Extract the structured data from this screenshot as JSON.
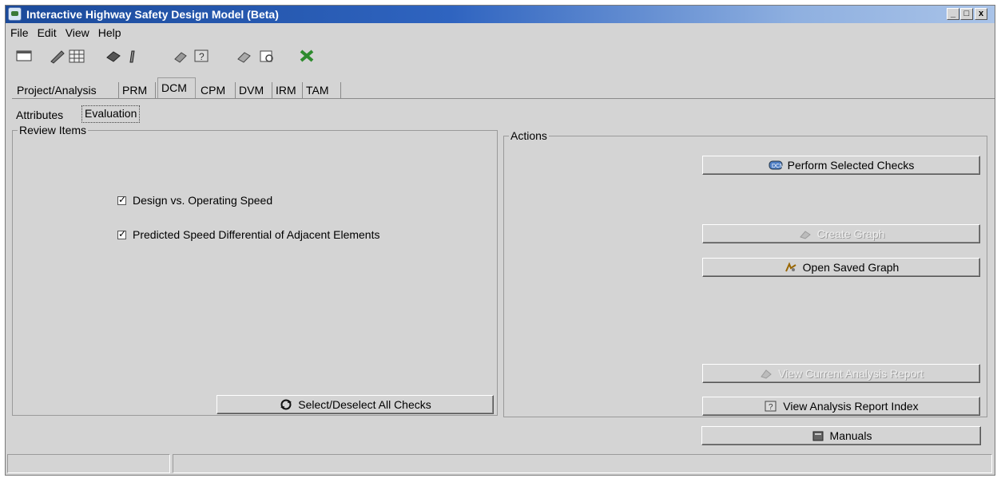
{
  "window": {
    "title": "Interactive Highway Safety Design Model (Beta)",
    "controls": [
      "_",
      "□",
      "x"
    ]
  },
  "menubar": {
    "items": [
      "File",
      "Edit",
      "View",
      "Help"
    ]
  },
  "toolbar": {
    "icons": [
      "window-icon",
      "pencil-icon",
      "grid-icon",
      "print-icon",
      "tools-icon",
      "document-icon",
      "help-icon",
      "eraser-icon",
      "preview-icon",
      "exit-icon"
    ]
  },
  "module_tabs": [
    {
      "label": "Project/Analysis",
      "active": false
    },
    {
      "label": "PRM",
      "active": false
    },
    {
      "label": "DCM",
      "active": true
    },
    {
      "label": "CPM",
      "active": false
    },
    {
      "label": "DVM",
      "active": false
    },
    {
      "label": "IRM",
      "active": false
    },
    {
      "label": "TAM",
      "active": false
    }
  ],
  "sub_tabs": [
    {
      "label": "Attributes",
      "active": false
    },
    {
      "label": "Evaluation",
      "active": true
    }
  ],
  "review_items": {
    "title": "Review Items",
    "checks": [
      {
        "label": "Design vs. Operating Speed",
        "checked": true
      },
      {
        "label": "Predicted Speed Differential of Adjacent Elements",
        "checked": true
      }
    ],
    "select_all_label": "Select/Deselect All Checks"
  },
  "actions": {
    "title": "Actions",
    "perform_label": "Perform Selected Checks",
    "create_graph_label": "Create Graph",
    "open_graph_label": "Open Saved Graph",
    "view_current_label": "View Current Analysis Report",
    "view_index_label": "View Analysis Report Index"
  },
  "footer": {
    "manuals_label": "Manuals"
  },
  "colors": {
    "title_gradient_start": "#1b4a9a",
    "title_gradient_end": "#a9c3e8",
    "window_bg": "#d4d4d4"
  }
}
